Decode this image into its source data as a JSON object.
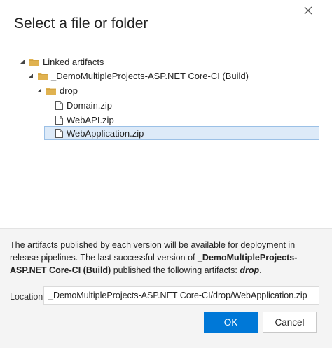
{
  "dialog": {
    "title": "Select a file or folder",
    "close_icon": "close-icon"
  },
  "tree": {
    "root": {
      "label": "Linked artifacts",
      "expanded": true,
      "icon": "folder-icon"
    },
    "build": {
      "label": "_DemoMultipleProjects-ASP.NET Core-CI (Build)",
      "expanded": true,
      "icon": "folder-icon"
    },
    "drop": {
      "label": "drop",
      "expanded": true,
      "icon": "folder-icon"
    },
    "files": [
      {
        "label": "Domain.zip",
        "icon": "file-icon",
        "selected": false
      },
      {
        "label": "WebAPI.zip",
        "icon": "file-icon",
        "selected": false
      },
      {
        "label": "WebApplication.zip",
        "icon": "file-icon",
        "selected": true
      }
    ]
  },
  "info": {
    "text_1": "The artifacts published by each version will be available for deployment in release pipelines. The last successful version of ",
    "build_name": "_DemoMultipleProjects-ASP.NET Core-CI (Build)",
    "text_2": " published the following artifacts: ",
    "artifact": "drop",
    "text_3": "."
  },
  "location": {
    "label": "Location",
    "value": "_DemoMultipleProjects-ASP.NET Core-CI/drop/WebApplication.zip"
  },
  "buttons": {
    "ok": "OK",
    "cancel": "Cancel"
  },
  "colors": {
    "accent": "#0078d7",
    "selection_bg": "#ddeaf8",
    "folder": "#e0b250",
    "panel_bg": "#f4f4f4"
  }
}
